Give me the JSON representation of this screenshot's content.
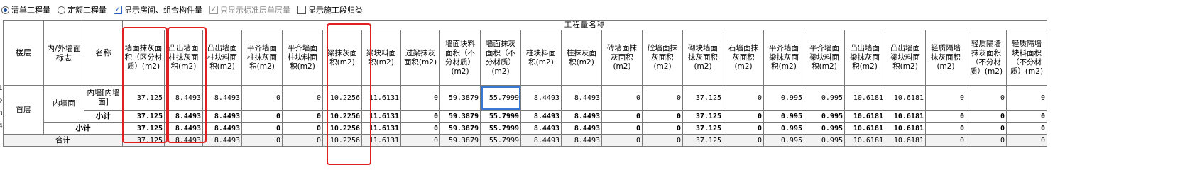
{
  "options": {
    "radio_list": "清单工程量",
    "radio_quota": "定额工程量",
    "cb_show_rooms": "显示房间、组合构件量",
    "cb_std_floor": "只显示标准层单层量",
    "cb_show_sections": "显示施工段归类"
  },
  "table": {
    "group_header": "工程量名称",
    "row_headers": {
      "floor": "楼层",
      "wall_flag": "内/外墙面标志",
      "name": "名称"
    },
    "columns": [
      "墙面抹灰面积（区分材质）(m2)",
      "凸出墙面柱抹灰面积(m2)",
      "凸出墙面柱块料面积(m2)",
      "平齐墙面柱抹灰面积(m2)",
      "平齐墙面柱块料面积(m2)",
      "梁抹灰面积(m2)",
      "梁块料面积(m2)",
      "过梁抹灰面积(m2)",
      "墙面块料面积（不分材质）(m2)",
      "墙面抹灰面积（不分材质）(m2)",
      "柱块料面积(m2)",
      "柱抹灰面积(m2)",
      "砖墙面抹灰面积(m2)",
      "砼墙面抹灰面积(m2)",
      "砌块墙面抹灰面积(m2)",
      "石墙面抹灰面积(m2)",
      "平齐墙面梁抹灰面积(m2)",
      "平齐墙面梁块料面积(m2)",
      "凸出墙面梁抹灰面积(m2)",
      "凸出墙面梁块料面积(m2)",
      "轻质隔墙抹灰面积(m2)",
      "轻质隔墙抹灰面积（不分材质）(m2)",
      "轻质隔墙块料面积（不分材质）(m2)"
    ],
    "rows": {
      "floor_label": "首层",
      "wall_label": "内墙面",
      "item_label": "内墙[内墙面]",
      "subtotal_label": "小计",
      "floor_subtotal_label": "小计",
      "total_label": "合计",
      "item_values": [
        "37.125",
        "8.4493",
        "8.4493",
        "0",
        "0",
        "10.2256",
        "11.6131",
        "0",
        "59.3879",
        "55.7999",
        "8.4493",
        "8.4493",
        "0",
        "0",
        "37.125",
        "0",
        "0.995",
        "0.995",
        "10.6181",
        "10.6181",
        "0",
        "0",
        "0"
      ],
      "subtotal_values": [
        "37.125",
        "8.4493",
        "8.4493",
        "0",
        "0",
        "10.2256",
        "11.6131",
        "0",
        "59.3879",
        "55.7999",
        "8.4493",
        "8.4493",
        "0",
        "0",
        "37.125",
        "0",
        "0.995",
        "0.995",
        "10.6181",
        "10.6181",
        "0",
        "0",
        "0"
      ],
      "floor_subtotal_values": [
        "37.125",
        "8.4493",
        "8.4493",
        "0",
        "0",
        "10.2256",
        "11.6131",
        "0",
        "59.3879",
        "55.7999",
        "8.4493",
        "8.4493",
        "0",
        "0",
        "37.125",
        "0",
        "0.995",
        "0.995",
        "10.6181",
        "10.6181",
        "0",
        "0",
        "0"
      ],
      "total_values": [
        "37.125",
        "8.4493",
        "8.4493",
        "0",
        "0",
        "10.2256",
        "11.6131",
        "0",
        "59.3879",
        "55.7999",
        "8.4493",
        "8.4493",
        "0",
        "0",
        "37.125",
        "0",
        "0.995",
        "0.995",
        "10.6181",
        "10.6181",
        "0",
        "0",
        "0"
      ]
    },
    "row_numbers": [
      "1",
      "2",
      "3",
      "4"
    ]
  }
}
